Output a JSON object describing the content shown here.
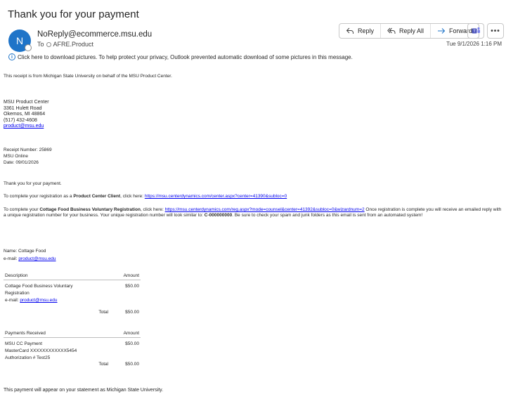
{
  "email": {
    "subject": "Thank you for your payment",
    "avatar_letter": "N",
    "sender": "NoReply@ecommerce.msu.edu",
    "to_label": "To",
    "to_recipient": "AFRE.Product",
    "datetime": "Tue 9/1/2026 1:16 PM",
    "actions": {
      "reply": "Reply",
      "reply_all": "Reply All",
      "forward": "Forward",
      "more": "•••"
    },
    "info_bar": "Click here to download pictures. To help protect your privacy, Outlook prevented automatic download of some pictures in this message.",
    "accent_color": "#1f74c8"
  },
  "body": {
    "intro": "This receipt is from Michigan State University on behalf of the MSU Product Center.",
    "address": {
      "org": "MSU Product Center",
      "street": "3361 Hulett Road",
      "city": "Okemos, MI 48864",
      "phone": "(517) 432-4608",
      "email": "product@msu.edu"
    },
    "receipt": {
      "number": "Receipt Number: 25869",
      "channel": "MSU Online",
      "date": "Date: 09/01/2026"
    },
    "thanks": "Thank you for your payment.",
    "reg1": {
      "pre": "To complete your registration as a ",
      "bold": "Product Center Client",
      "mid": ", click here: ",
      "link": "https://msu.centerdynamics.com/center.aspx?center=41390&subloc=0"
    },
    "reg2": {
      "pre": "To complete your ",
      "bold": "Cottage Food Business Voluntary Registration",
      "mid": ", click here: ",
      "link": "https://msu.centerdynamics.com/reg.aspx?mode=counsel&center=41392&subloc=0&wizardnum=2",
      "post": " Once registration is complete you will receive an emailed reply with a unique registration number for your business. Your unique registration number will look similar to: ",
      "sample": "C-000000000",
      "tail": ". Be sure to check your spam and junk folders as this email is sent from an automated system!"
    },
    "contact": {
      "name": "Name: Cottage Food",
      "email_label": "e-mail: ",
      "email": "product@msu.edu"
    },
    "items_table": {
      "col_desc": "Description",
      "col_amount": "Amount",
      "item_desc": "Cottage Food Business Voluntary Registration",
      "item_email_label": "e-mail: ",
      "item_email": "product@msu.edu",
      "item_amount": "$50.00",
      "total_label": "Total",
      "total_amount": "$50.00"
    },
    "payments_table": {
      "col_desc": "Payments Received",
      "col_amount": "Amount",
      "method": "MSU CC Payment",
      "card": "MasterCard XXXXXXXXXXXX5454",
      "auth": "Authorization # Test25",
      "amount": "$50.00",
      "total_label": "Total",
      "total_amount": "$50.00"
    },
    "footer": "This payment will appear on your statement as Michigan State University."
  }
}
